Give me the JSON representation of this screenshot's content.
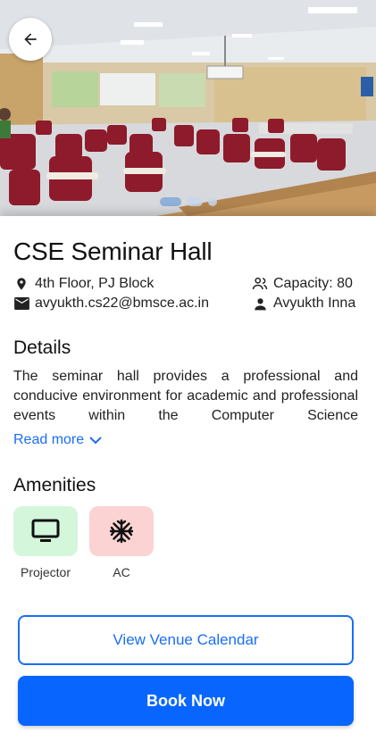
{
  "hero": {
    "image_alt": "Seminar hall interior with red chairs",
    "back_icon": "arrow-left-icon",
    "carousel_pages": 3,
    "carousel_active": 1
  },
  "venue": {
    "name": "CSE Seminar Hall",
    "location": "4th Floor, PJ Block",
    "email": "avyukth.cs22@bmsce.ac.in",
    "capacity": "Capacity: 80",
    "contact_person": "Avyukth Inna"
  },
  "details": {
    "heading": "Details",
    "description": "The seminar hall provides a professional and conducive environment for academic and professional events within the Computer Science",
    "read_more_label": "Read more"
  },
  "amenities": {
    "heading": "Amenities",
    "items": [
      {
        "label": "Projector",
        "icon": "monitor-icon",
        "bg": "#d4f7dc"
      },
      {
        "label": "AC",
        "icon": "snowflake-icon",
        "bg": "#fbd3d3"
      }
    ]
  },
  "actions": {
    "calendar_label": "View Venue Calendar",
    "book_label": "Book Now"
  },
  "colors": {
    "accent": "#1a6ef5",
    "primary_button": "#0866ff"
  }
}
